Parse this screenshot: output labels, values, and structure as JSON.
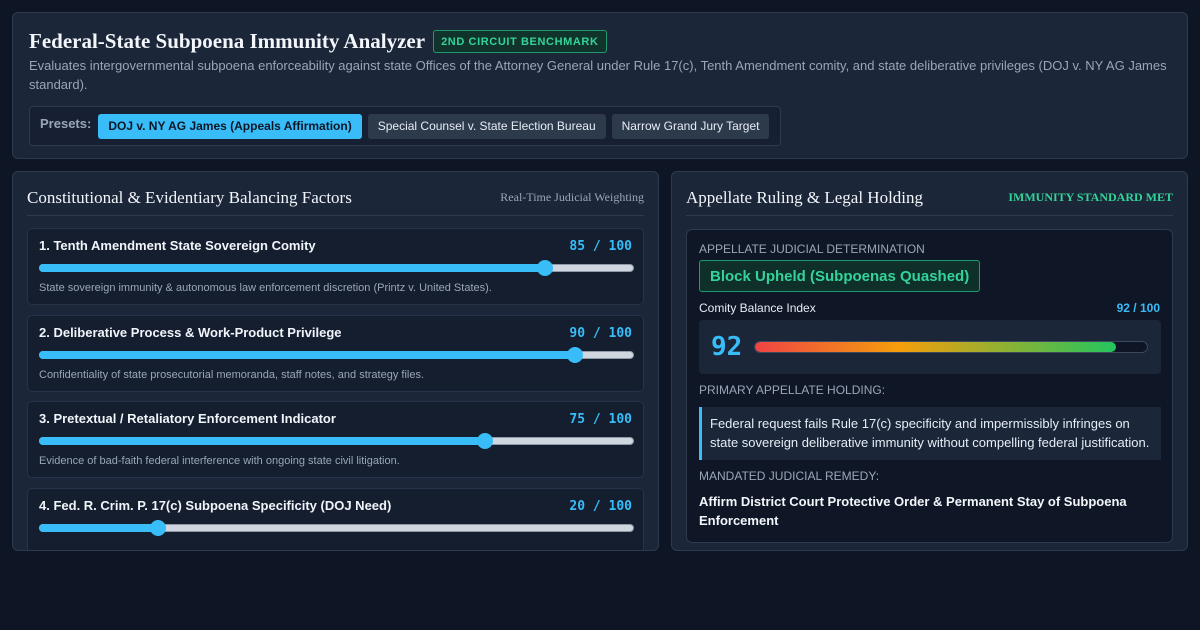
{
  "header": {
    "title": "Federal-State Subpoena Immunity Analyzer",
    "badge": "2ND CIRCUIT BENCHMARK",
    "subtitle": "Evaluates intergovernmental subpoena enforceability against state Offices of the Attorney General under Rule 17(c), Tenth Amendment comity, and state deliberative privileges (DOJ v. NY AG James standard)."
  },
  "presets": {
    "label": "Presets:",
    "items": [
      {
        "label": "DOJ v. NY AG James (Appeals Affirmation)",
        "active": true
      },
      {
        "label": "Special Counsel v. State Election Bureau",
        "active": false
      },
      {
        "label": "Narrow Grand Jury Target",
        "active": false
      }
    ]
  },
  "factors_panel": {
    "title": "Constitutional & Evidentiary Balancing Factors",
    "tag": "Real-Time Judicial Weighting",
    "factors": [
      {
        "name": "1. Tenth Amendment State Sovereign Comity",
        "score_text": "85 / 100",
        "value": 85,
        "description": "State sovereign immunity & autonomous law enforcement discretion (Printz v. United States)."
      },
      {
        "name": "2. Deliberative Process & Work-Product Privilege",
        "score_text": "90 / 100",
        "value": 90,
        "description": "Confidentiality of state prosecutorial memoranda, staff notes, and strategy files."
      },
      {
        "name": "3. Pretextual / Retaliatory Enforcement Indicator",
        "score_text": "75 / 100",
        "value": 75,
        "description": "Evidence of bad-faith federal interference with ongoing state civil litigation."
      },
      {
        "name": "4. Fed. R. Crim. P. 17(c) Subpoena Specificity (DOJ Need)",
        "score_text": "20 / 100",
        "value": 20,
        "description": ""
      }
    ]
  },
  "ruling_panel": {
    "title": "Appellate Ruling & Legal Holding",
    "tag": "IMMUNITY STANDARD MET",
    "determination_label": "APPELLATE JUDICIAL DETERMINATION",
    "verdict": "Block Upheld (Subpoenas Quashed)",
    "comity_label": "Comity Balance Index",
    "comity_value_text": "92 / 100",
    "comity_number": "92",
    "comity_value": 92,
    "holding_label": "PRIMARY APPELLATE HOLDING:",
    "holding_text": "Federal request fails Rule 17(c) specificity and impermissibly infringes on state sovereign deliberative immunity without compelling federal justification.",
    "remedy_label": "MANDATED JUDICIAL REMEDY:",
    "remedy_text": "Affirm District Court Protective Order & Permanent Stay of Subpoena Enforcement"
  },
  "colors": {
    "accent": "#38bdf8",
    "success": "#34d399",
    "background": "#0e1626",
    "panel": "#1b2638"
  }
}
